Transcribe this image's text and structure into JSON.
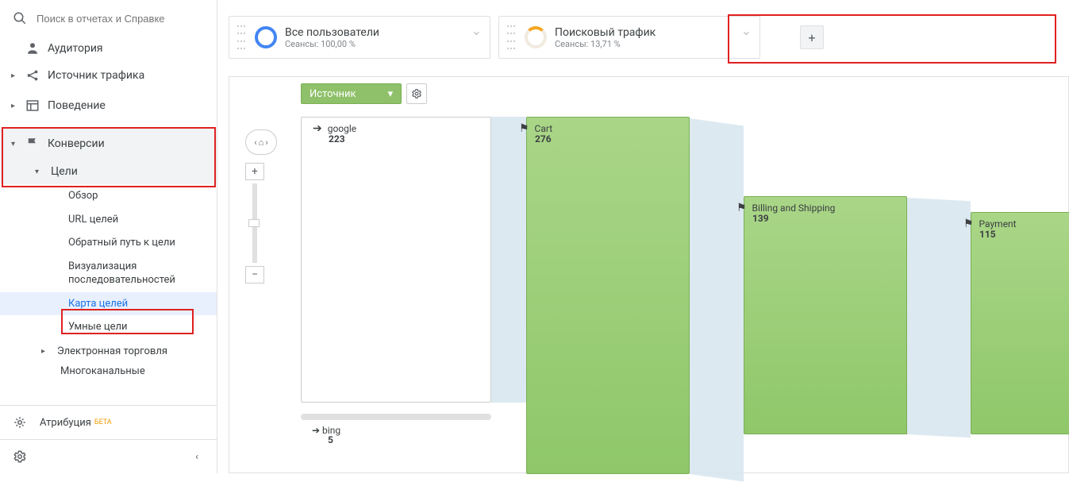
{
  "search": {
    "placeholder": "Поиск в отчетах и Справке"
  },
  "nav": {
    "audience": "Аудитория",
    "traffic_source": "Источник трафика",
    "behavior": "Поведение",
    "conversions": "Конверсии",
    "goals": "Цели",
    "overview": "Обзор",
    "url_goals": "URL целей",
    "reverse_path": "Обратный путь к цели",
    "funnel_viz": "Визуализация последовательностей",
    "goal_map": "Карта целей",
    "smart_goals": "Умные цели",
    "ecommerce": "Электронная торговля",
    "multichannel": "Многоканальные",
    "attribution": "Атрибуция",
    "beta": "БЕТА"
  },
  "segments": {
    "all_users": {
      "title": "Все пользователи",
      "sub": "Сеансы: 100,00 %"
    },
    "search_traffic": {
      "title": "Поисковый трафик",
      "sub": "Сеансы: 13,71 %"
    }
  },
  "toolbar": {
    "dimension": "Источник"
  },
  "sources": {
    "google": {
      "name": "google",
      "count": "223"
    },
    "bing": {
      "name": "bing",
      "count": "5"
    }
  },
  "steps": {
    "cart": {
      "name": "Cart",
      "count": "276"
    },
    "billing": {
      "name": "Billing and Shipping",
      "count": "139"
    },
    "payment": {
      "name": "Payment",
      "count": "115"
    }
  }
}
